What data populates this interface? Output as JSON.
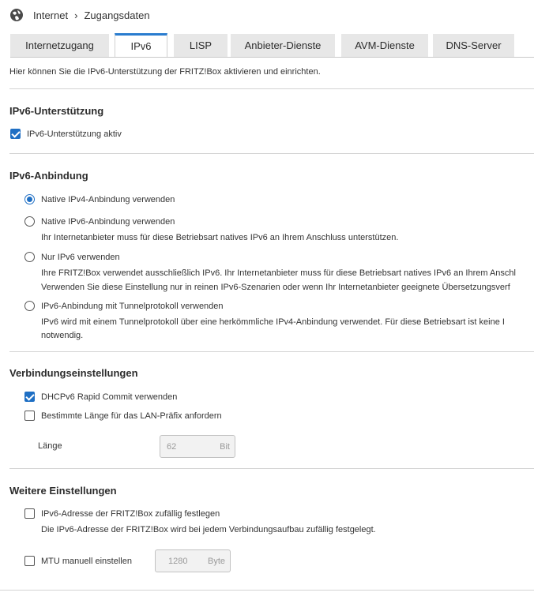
{
  "breadcrumb": {
    "root": "Internet",
    "separator": "›",
    "current": "Zugangsdaten"
  },
  "tabs": [
    {
      "label": "Internetzugang",
      "active": false
    },
    {
      "label": "IPv6",
      "active": true
    },
    {
      "label": "LISP",
      "active": false
    },
    {
      "label": "Anbieter-Dienste",
      "active": false
    },
    {
      "label": "AVM-Dienste",
      "active": false
    },
    {
      "label": "DNS-Server",
      "active": false
    }
  ],
  "intro": "Hier können Sie die IPv6-Unterstützung der FRITZ!Box aktivieren und einrichten.",
  "support": {
    "title": "IPv6-Unterstützung",
    "checkbox_label": "IPv6-Unterstützung aktiv",
    "checked": true
  },
  "connection": {
    "title": "IPv6-Anbindung",
    "options": [
      {
        "label": "Native IPv4-Anbindung verwenden",
        "selected": true,
        "desc": []
      },
      {
        "label": "Native IPv6-Anbindung verwenden",
        "selected": false,
        "desc": [
          "Ihr Internetanbieter muss für diese Betriebsart natives IPv6 an Ihrem Anschluss unterstützen."
        ]
      },
      {
        "label": "Nur IPv6 verwenden",
        "selected": false,
        "desc": [
          "Ihre FRITZ!Box verwendet ausschließlich IPv6. Ihr Internetanbieter muss für diese Betriebsart natives IPv6 an Ihrem Anschl",
          "Verwenden Sie diese Einstellung nur in reinen IPv6-Szenarien oder wenn Ihr Internetanbieter geeignete Übersetzungsverf"
        ]
      },
      {
        "label": "IPv6-Anbindung mit Tunnelprotokoll verwenden",
        "selected": false,
        "desc": [
          "IPv6 wird mit einem Tunnelprotokoll über eine herkömmliche IPv4-Anbindung verwendet. Für diese Betriebsart ist keine I",
          "notwendig."
        ]
      }
    ]
  },
  "settings": {
    "title": "Verbindungseinstellungen",
    "rapid_commit": {
      "label": "DHCPv6 Rapid Commit verwenden",
      "checked": true
    },
    "prefix_length": {
      "label": "Bestimmte Länge für das LAN-Präfix anfordern",
      "checked": false
    },
    "length_field": {
      "label": "Länge",
      "value": "62",
      "unit": "Bit"
    }
  },
  "more": {
    "title": "Weitere Einstellungen",
    "random_address": {
      "label": "IPv6-Adresse der FRITZ!Box zufällig festlegen",
      "checked": false,
      "desc": "Die IPv6-Adresse der FRITZ!Box wird bei jedem Verbindungsaufbau zufällig festgelegt."
    },
    "mtu": {
      "label": "MTU manuell einstellen",
      "checked": false,
      "value": "1280",
      "unit": "Byte"
    }
  },
  "colors": {
    "accent": "#1f6fc4",
    "tab_bg": "#e7e7e7",
    "divider": "#d3d3d3"
  }
}
